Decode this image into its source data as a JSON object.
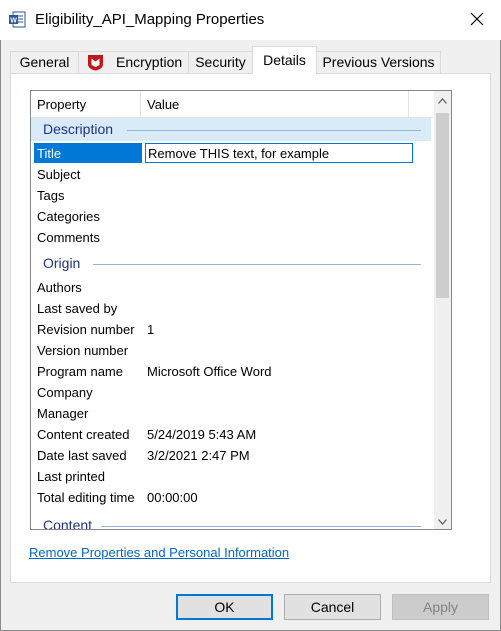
{
  "window": {
    "title": "Eligibility_API_Mapping Properties",
    "icon": "word-document-icon",
    "close_icon": "close-icon"
  },
  "tabs": [
    {
      "label": "General"
    },
    {
      "label": "Encryption",
      "icon": "mcafee-shield-icon",
      "icon_color": "#c01818"
    },
    {
      "label": "Security"
    },
    {
      "label": "Details",
      "active": true
    },
    {
      "label": "Previous Versions"
    }
  ],
  "details": {
    "columns": {
      "property": "Property",
      "value": "Value"
    },
    "groups": {
      "description": "Description",
      "origin": "Origin",
      "content": "Content"
    },
    "description_rows": [
      {
        "name": "Title",
        "value": "Remove THIS text, for example"
      },
      {
        "name": "Subject",
        "value": ""
      },
      {
        "name": "Tags",
        "value": ""
      },
      {
        "name": "Categories",
        "value": ""
      },
      {
        "name": "Comments",
        "value": ""
      }
    ],
    "origin_rows": [
      {
        "name": "Authors",
        "value": ""
      },
      {
        "name": "Last saved by",
        "value": ""
      },
      {
        "name": "Revision number",
        "value": "1"
      },
      {
        "name": "Version number",
        "value": ""
      },
      {
        "name": "Program name",
        "value": "Microsoft Office Word"
      },
      {
        "name": "Company",
        "value": ""
      },
      {
        "name": "Manager",
        "value": ""
      },
      {
        "name": "Content created",
        "value": "5/24/2019 5:43 AM"
      },
      {
        "name": "Date last saved",
        "value": "3/2/2021 2:47 PM"
      },
      {
        "name": "Last printed",
        "value": ""
      },
      {
        "name": "Total editing time",
        "value": "00:00:00"
      }
    ]
  },
  "links": {
    "remove_properties": "Remove Properties and Personal Information"
  },
  "buttons": {
    "ok": "OK",
    "cancel": "Cancel",
    "apply": "Apply"
  },
  "colors": {
    "accent": "#0078d7",
    "group_text": "#1e3287",
    "link": "#0066cc"
  }
}
